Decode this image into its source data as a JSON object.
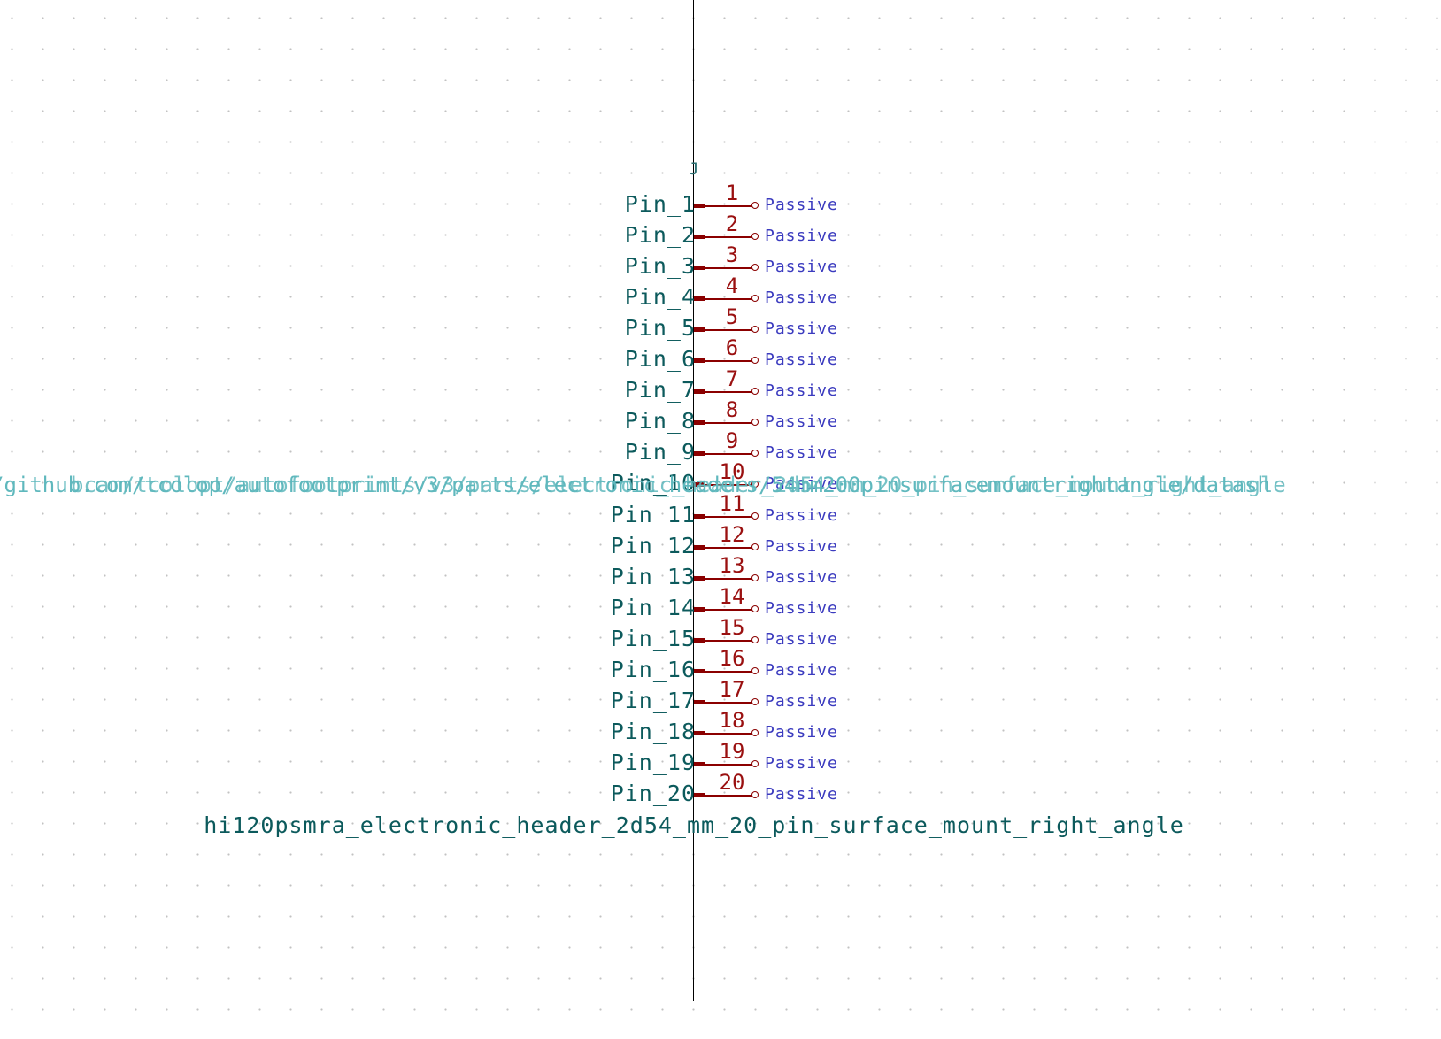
{
  "component": {
    "reference": "J",
    "value": "hi120psmra_electronic_header_2d54_mm_20_pin_surface_mount_right_angle",
    "overlay_text": "/github.com/tcolop/autofootprint/v3/parts/electronic_headers/54mm200pinsurfacemountrightangle/datash",
    "overlay_text_2": "bcam/tcolopt/autofootprints/v3/parts/electronic_header_2d54_mm_20_pin_surface_mount_right_angle"
  },
  "pins": [
    {
      "name": "Pin_1",
      "number": "1",
      "type": "Passive"
    },
    {
      "name": "Pin_2",
      "number": "2",
      "type": "Passive"
    },
    {
      "name": "Pin_3",
      "number": "3",
      "type": "Passive"
    },
    {
      "name": "Pin_4",
      "number": "4",
      "type": "Passive"
    },
    {
      "name": "Pin_5",
      "number": "5",
      "type": "Passive"
    },
    {
      "name": "Pin_6",
      "number": "6",
      "type": "Passive"
    },
    {
      "name": "Pin_7",
      "number": "7",
      "type": "Passive"
    },
    {
      "name": "Pin_8",
      "number": "8",
      "type": "Passive"
    },
    {
      "name": "Pin_9",
      "number": "9",
      "type": "Passive"
    },
    {
      "name": "Pin_10",
      "number": "10",
      "type": "Passive"
    },
    {
      "name": "Pin_11",
      "number": "11",
      "type": "Passive"
    },
    {
      "name": "Pin_12",
      "number": "12",
      "type": "Passive"
    },
    {
      "name": "Pin_13",
      "number": "13",
      "type": "Passive"
    },
    {
      "name": "Pin_14",
      "number": "14",
      "type": "Passive"
    },
    {
      "name": "Pin_15",
      "number": "15",
      "type": "Passive"
    },
    {
      "name": "Pin_16",
      "number": "16",
      "type": "Passive"
    },
    {
      "name": "Pin_17",
      "number": "17",
      "type": "Passive"
    },
    {
      "name": "Pin_18",
      "number": "18",
      "type": "Passive"
    },
    {
      "name": "Pin_19",
      "number": "19",
      "type": "Passive"
    },
    {
      "name": "Pin_20",
      "number": "20",
      "type": "Passive"
    }
  ],
  "colors": {
    "background": "#ffffff",
    "grid_dot": "#c2c2c2",
    "pin_name": "#0c5a5c",
    "pin_number": "#9a1010",
    "pin_line": "#8b0000",
    "pin_type": "#3b3bbf",
    "overlay_text": "#5fb8bd"
  }
}
